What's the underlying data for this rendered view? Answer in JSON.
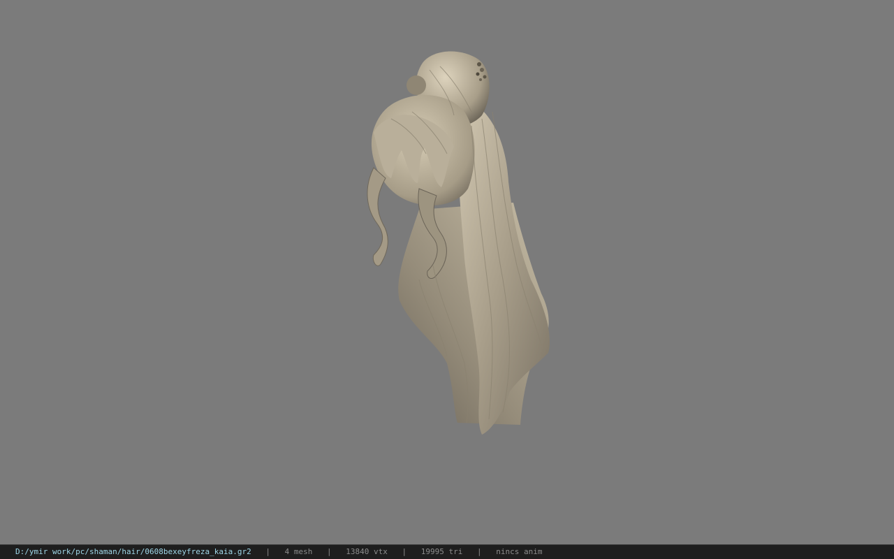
{
  "status_bar": {
    "file_path": "D:/ymir work/pc/shaman/hair/0608bexeyfreza_kaia.gr2",
    "separator": "|",
    "mesh_count": "4 mesh",
    "vertex_count": "13840 vtx",
    "triangle_count": "19995 tri",
    "anim_status": "nincs anim"
  },
  "colors": {
    "viewport_background": "#7b7b7b",
    "status_bar_background": "#1e1e1e",
    "path_text": "#9fd7e8",
    "stat_text": "#8c8c8c",
    "hair_light": "#c9bfa9",
    "hair_mid": "#a79d89",
    "hair_dark": "#6e675a"
  },
  "viewport": {
    "model": "hair-model"
  }
}
